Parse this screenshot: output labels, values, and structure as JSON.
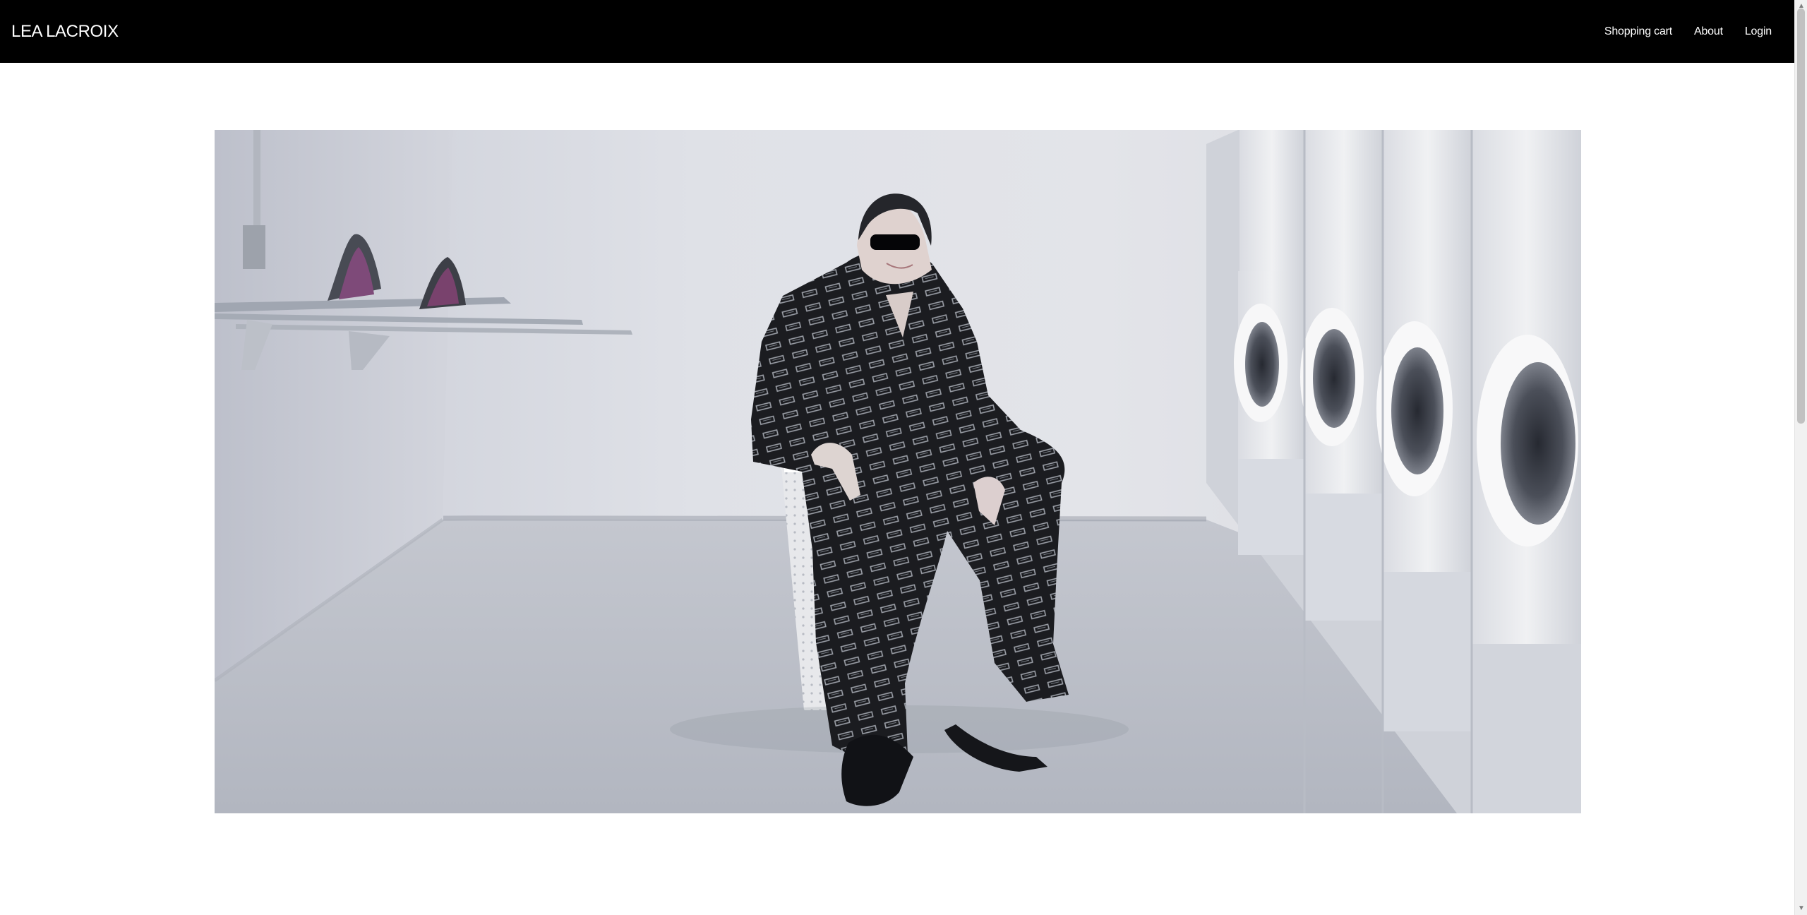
{
  "app": {
    "brand": "LEA LACROIX"
  },
  "nav": {
    "links": [
      {
        "label": "Shopping cart"
      },
      {
        "label": "About"
      },
      {
        "label": "Login"
      }
    ]
  },
  "hero": {
    "image": "fashion-model-in-laundry-room"
  },
  "colors": {
    "header_bg": "#000000",
    "header_text": "#ffffff",
    "page_bg": "#ffffff"
  },
  "icons": {
    "scroll_up": "scroll-up-arrow-icon",
    "scroll_down": "scroll-down-arrow-icon"
  }
}
